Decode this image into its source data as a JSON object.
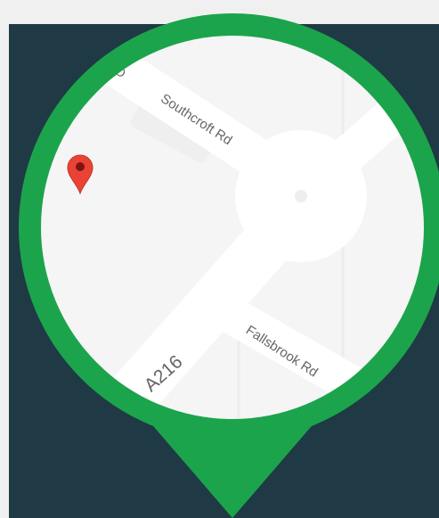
{
  "colors": {
    "page_bg": "#f0f0f0",
    "panel_bg": "#1f3a44",
    "pin_ring": "#1ca44c",
    "map_bg": "#f5f5f5",
    "road": "#ffffff",
    "road_label": "#666666",
    "marker_red": "#ea4335",
    "marker_dot": "#7a1515"
  },
  "map": {
    "road_labels": [
      {
        "id": "southcroft",
        "text": "Southcroft Rd"
      },
      {
        "id": "fallsbrook",
        "text": "Fallsbrook Rd"
      },
      {
        "id": "a216",
        "text": "A216"
      },
      {
        "id": "partial",
        "text": "D"
      }
    ],
    "marker_icon": "map-pin-icon"
  }
}
